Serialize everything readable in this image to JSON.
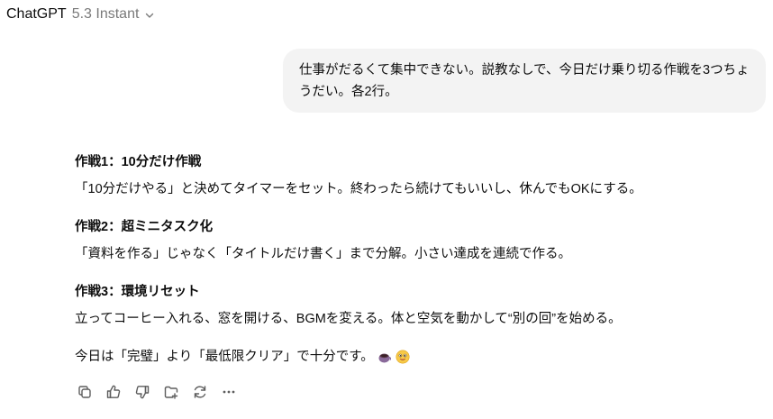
{
  "header": {
    "brand": "ChatGPT",
    "version": "5.3 Instant",
    "chevron_icon": "chevron-down-icon"
  },
  "conversation": {
    "user_message": "仕事がだるくて集中できない。説教なしで、今日だけ乗り切る作戦を3つちょうだい。各2行。",
    "assistant": {
      "tactics": [
        {
          "title": "作戦1：10分だけ作戦",
          "body": "「10分だけやる」と決めてタイマーをセット。終わったら続けてもいいし、休んでもOKにする。"
        },
        {
          "title": "作戦2：超ミニタスク化",
          "body": "「資料を作る」じゃなく「タイトルだけ書く」まで分解。小さい達成を連続で作る。"
        },
        {
          "title": "作戦3：環境リセット",
          "body": "立ってコーヒー入れる、窓を開ける、BGMを変える。体と空気を動かして“別の回”を始める。"
        }
      ],
      "closing": "今日は「完璧」より「最低限クリア」で十分です。",
      "closing_emojis": [
        "coffee-cup-icon",
        "smiling-face-icon"
      ]
    }
  },
  "actions": [
    {
      "name": "copy-button",
      "icon": "copy-icon"
    },
    {
      "name": "thumbs-up-button",
      "icon": "thumbs-up-icon"
    },
    {
      "name": "thumbs-down-button",
      "icon": "thumbs-down-icon"
    },
    {
      "name": "share-button",
      "icon": "share-icon"
    },
    {
      "name": "regenerate-button",
      "icon": "refresh-icon"
    },
    {
      "name": "more-options-button",
      "icon": "more-dots-icon"
    }
  ],
  "colors": {
    "text": "#0d0d0d",
    "muted": "#7a7a7a",
    "bubble": "#f3f3f3",
    "icon": "#5d5d5d"
  }
}
